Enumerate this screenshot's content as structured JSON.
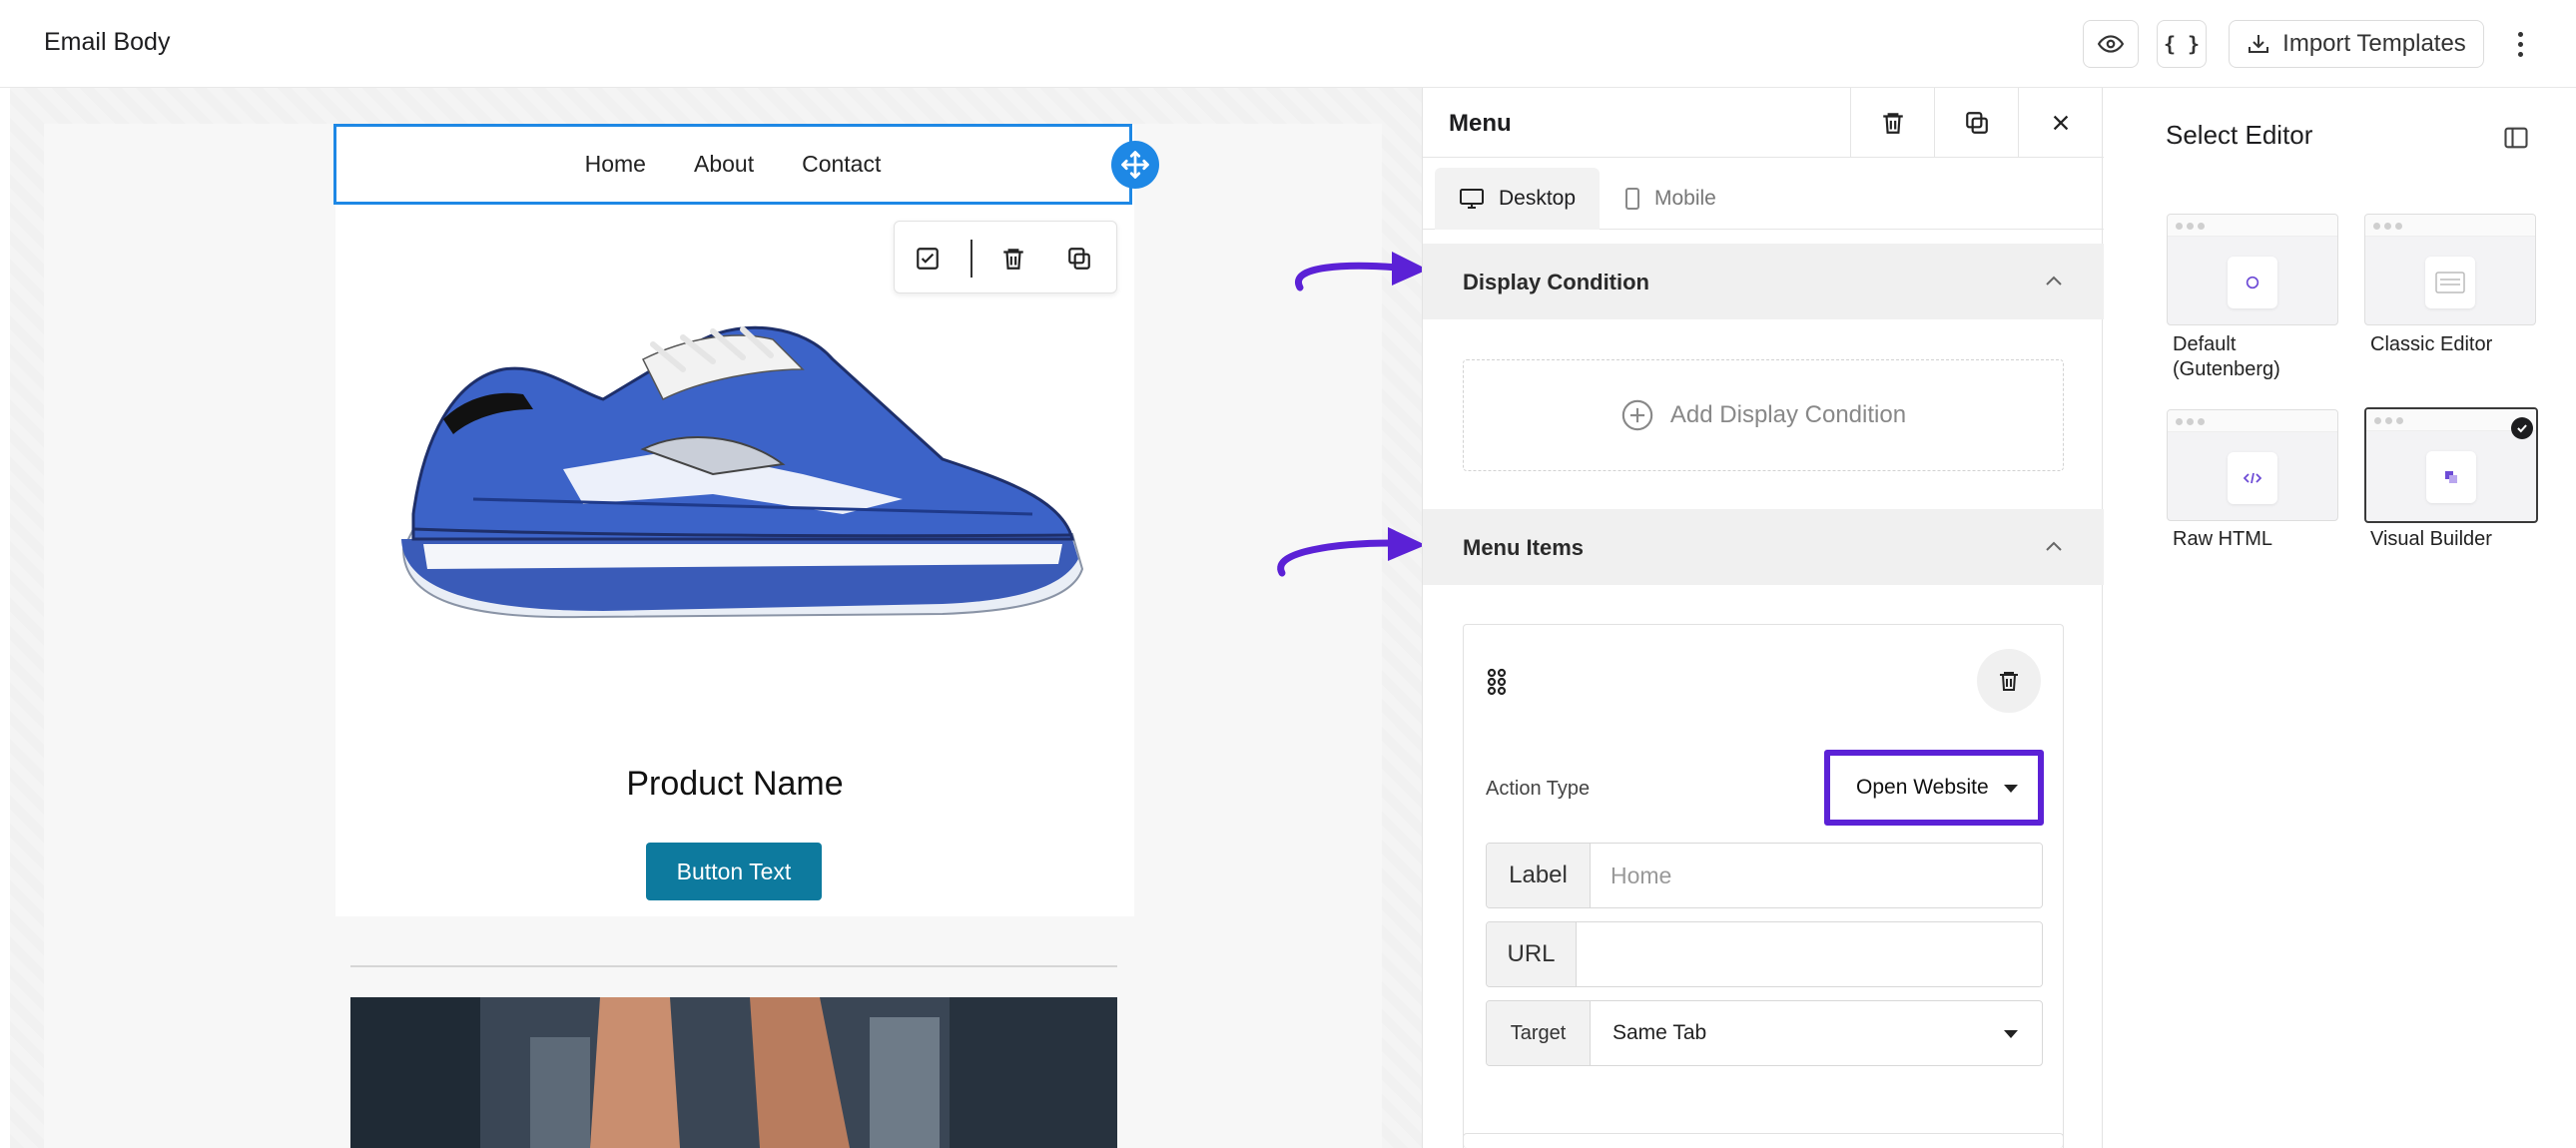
{
  "header": {
    "title": "Email Body",
    "preview_icon": "eye-icon",
    "code_label": "{ }",
    "import_label": "Import Templates",
    "more_icon": "vertical-dots-icon"
  },
  "canvas": {
    "menu_items": [
      "Home",
      "About",
      "Contact"
    ],
    "product_name": "Product Name",
    "button_text": "Button Text",
    "colors": {
      "selection": "#1e88e5",
      "cta": "#0d7a9e"
    }
  },
  "panel": {
    "title": "Menu",
    "tabs": [
      {
        "label": "Desktop",
        "active": true
      },
      {
        "label": "Mobile",
        "active": false
      }
    ],
    "sections": {
      "display_condition": "Display Condition",
      "add_condition": "Add Display Condition",
      "menu_items": "Menu Items"
    },
    "item": {
      "action_type_label": "Action Type",
      "action_type_value": "Open Website",
      "label_addon": "Label",
      "label_placeholder": "Home",
      "url_addon": "URL",
      "url_value": "",
      "target_addon": "Target",
      "target_value": "Same Tab"
    },
    "highlight_color": "#5b21d6"
  },
  "editor": {
    "title": "Select Editor",
    "options": [
      {
        "label": "Default (Gutenberg)",
        "selected": false
      },
      {
        "label": "Classic Editor",
        "selected": false
      },
      {
        "label": "Raw HTML",
        "selected": false
      },
      {
        "label": "Visual Builder",
        "selected": true
      }
    ]
  }
}
